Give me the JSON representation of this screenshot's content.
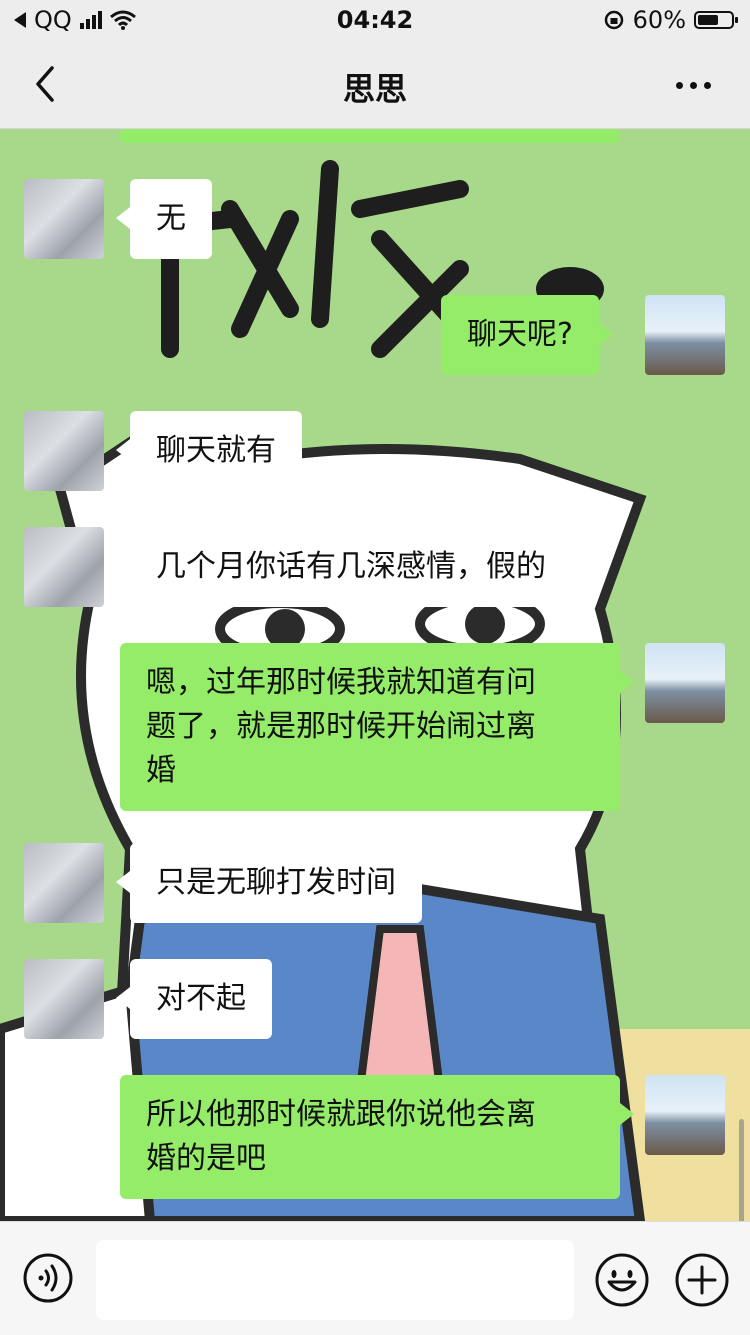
{
  "status_bar": {
    "carrier": "QQ",
    "time": "04:42",
    "battery": "60%",
    "icons": [
      "back-arrow-icon",
      "signal-icon",
      "wifi-icon",
      "rotation-lock-icon",
      "battery-icon"
    ]
  },
  "nav": {
    "title": "思思",
    "back_icon": "chevron-left-icon",
    "more_icon": "more-dots-icon"
  },
  "messages": [
    {
      "from": "other",
      "text": "无"
    },
    {
      "from": "me",
      "text": "聊天呢?"
    },
    {
      "from": "other",
      "text": "聊天就有"
    },
    {
      "from": "other",
      "text": "几个月你话有几深感情，假的"
    },
    {
      "from": "me",
      "text": "嗯，过年那时候我就知道有问题了，就是那时候开始闹过离婚"
    },
    {
      "from": "other",
      "text": "只是无聊打发时间"
    },
    {
      "from": "other",
      "text": "对不起"
    },
    {
      "from": "me",
      "text": "所以他那时候就跟你说他会离婚的是吧"
    }
  ],
  "message_lines": {
    "m4": [
      "嗯，过年那时候我就知道有问",
      "题了，就是那时候开始闹过离",
      "婚"
    ],
    "m7": [
      "所以他那时候就跟你说他会离",
      "婚的是吧"
    ]
  },
  "input_bar": {
    "icons": [
      "voice-icon",
      "emoji-icon",
      "plus-icon"
    ],
    "value": ""
  },
  "colors": {
    "my_bubble": "#95ec69",
    "their_bubble": "#ffffff",
    "chat_background": "#a8d98b",
    "header": "#ededed"
  }
}
